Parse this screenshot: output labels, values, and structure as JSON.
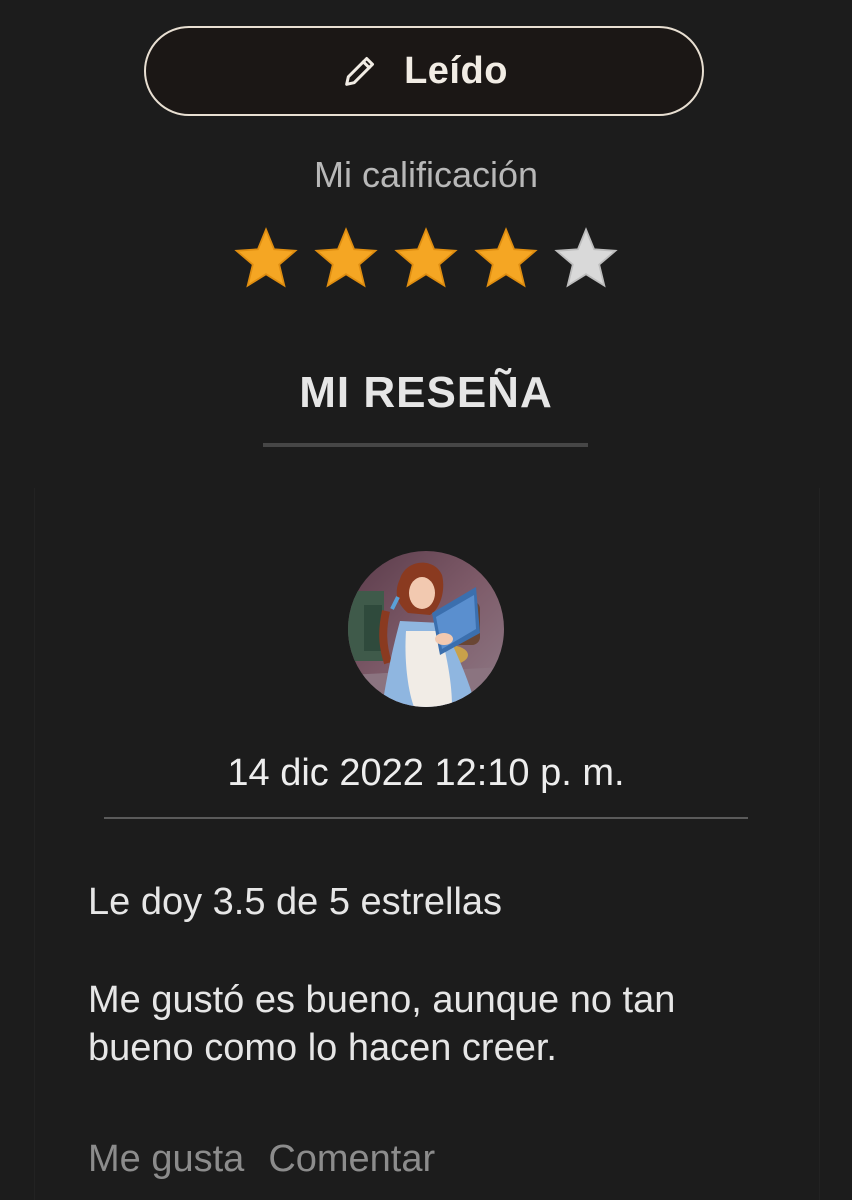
{
  "shelf_button": {
    "label": "Leído",
    "icon": "pencil-icon"
  },
  "rating": {
    "label": "Mi calificación",
    "value": 4,
    "max": 5,
    "filled_color": "#f5a623",
    "empty_color": "#d9d9d9"
  },
  "review": {
    "heading": "MI RESEÑA",
    "avatar": "user-avatar",
    "date": "14 dic 2022 12:10 p. m.",
    "paragraphs": [
      "Le doy 3.5 de 5 estrellas",
      "Me gustó es bueno, aunque no tan bueno como lo hacen creer."
    ],
    "actions": {
      "like": "Me gusta",
      "comment": "Comentar"
    }
  }
}
